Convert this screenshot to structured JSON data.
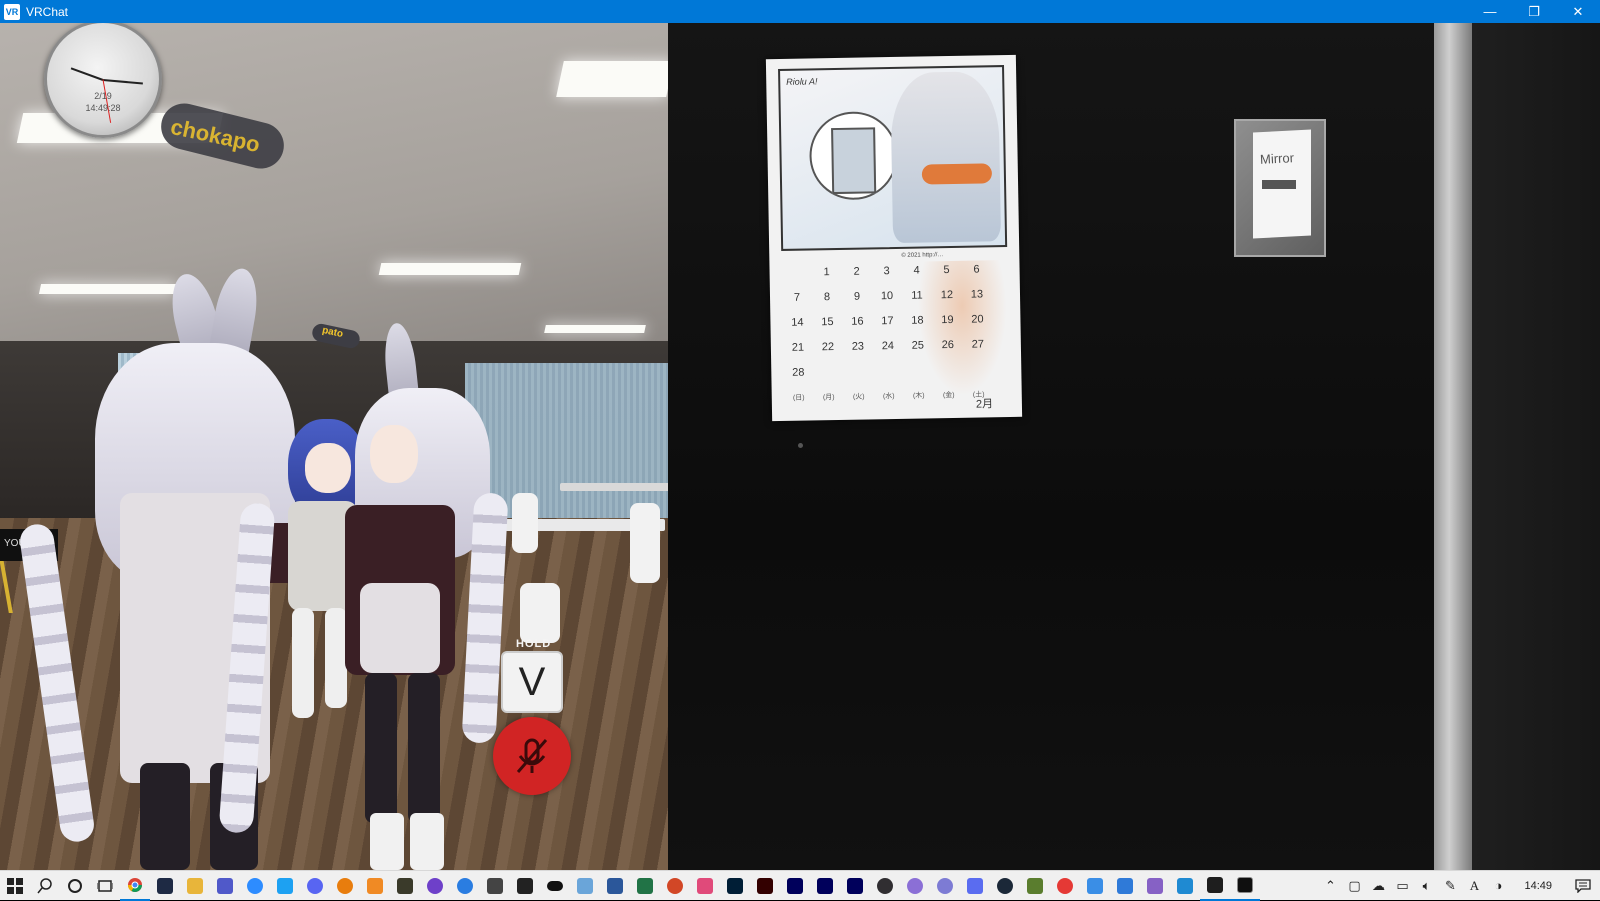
{
  "window": {
    "app_icon_text": "VR",
    "title": "VRChat",
    "minimize_glyph": "—",
    "restore_glyph": "❐",
    "close_glyph": "✕"
  },
  "scene": {
    "clock": {
      "date": "2/19",
      "time": "14:49:28"
    },
    "nameplate_large": "chokapo",
    "nameplate_small": "pato",
    "screen_text": "YOU",
    "hud": {
      "hold_label": "HOLD",
      "hold_key": "V",
      "mic_status_icon": "microphone-muted-icon",
      "mic_color": "#d12424"
    },
    "calendar": {
      "signature": "Riolu A!",
      "footer": "© 2021 http://…",
      "rows": [
        [
          "",
          "1",
          "2",
          "3",
          "4",
          "5",
          "6"
        ],
        [
          "7",
          "8",
          "9",
          "10",
          "11",
          "12",
          "13"
        ],
        [
          "14",
          "15",
          "16",
          "17",
          "18",
          "19",
          "20"
        ],
        [
          "21",
          "22",
          "23",
          "24",
          "25",
          "26",
          "27"
        ],
        [
          "28",
          "",
          "",
          "",
          "",
          "",
          ""
        ]
      ],
      "weekdays": [
        "(日)",
        "(月)",
        "(火)",
        "(水)",
        "(木)",
        "(金)",
        "(土)"
      ],
      "month": "2月"
    },
    "mirror_switch_label": "Mirror"
  },
  "taskbar": {
    "apps": [
      {
        "name": "file-explorer",
        "color": "#e8b53a"
      },
      {
        "name": "teams",
        "color": "#5059c9"
      },
      {
        "name": "zoom",
        "color": "#2d8cff"
      },
      {
        "name": "twitter",
        "color": "#1da1f2"
      },
      {
        "name": "discord",
        "color": "#5865f2"
      },
      {
        "name": "blender",
        "color": "#e87d0d"
      },
      {
        "name": "app-orange",
        "color": "#f08a24"
      },
      {
        "name": "app-dark",
        "color": "#3a3a2a"
      },
      {
        "name": "github",
        "color": "#6e40c9"
      },
      {
        "name": "maps",
        "color": "#2a7de1"
      },
      {
        "name": "unity",
        "color": "#444444"
      },
      {
        "name": "epic",
        "color": "#222222"
      },
      {
        "name": "oculus",
        "color": "#111111"
      },
      {
        "name": "notepad",
        "color": "#6aa5d9"
      },
      {
        "name": "word",
        "color": "#2b579a"
      },
      {
        "name": "excel",
        "color": "#217346"
      },
      {
        "name": "powerpoint",
        "color": "#d24726"
      },
      {
        "name": "app-pink",
        "color": "#e04a7a"
      },
      {
        "name": "photoshop",
        "color": "#001e36"
      },
      {
        "name": "illustrator",
        "color": "#330000"
      },
      {
        "name": "media-encoder",
        "color": "#00005b"
      },
      {
        "name": "premiere",
        "color": "#00005b"
      },
      {
        "name": "after-effects",
        "color": "#00005b"
      },
      {
        "name": "obs",
        "color": "#302e31"
      },
      {
        "name": "app-purple",
        "color": "#8b6fd6"
      },
      {
        "name": "app-violet",
        "color": "#7d7bd4"
      },
      {
        "name": "app-blue-w",
        "color": "#5a6cf0"
      },
      {
        "name": "steam",
        "color": "#1b2838"
      },
      {
        "name": "minecraft",
        "color": "#5a7d2e"
      },
      {
        "name": "app-red",
        "color": "#e53935"
      },
      {
        "name": "app-azure",
        "color": "#3a8ee6"
      },
      {
        "name": "app-vz",
        "color": "#2f7ad8"
      },
      {
        "name": "visual-studio",
        "color": "#8661c5"
      },
      {
        "name": "vscode",
        "color": "#1f8ad2"
      },
      {
        "name": "terminal",
        "color": "#1e1e1e"
      },
      {
        "name": "vrchat",
        "color": "#0f0f0f"
      }
    ],
    "time": "14:49"
  }
}
